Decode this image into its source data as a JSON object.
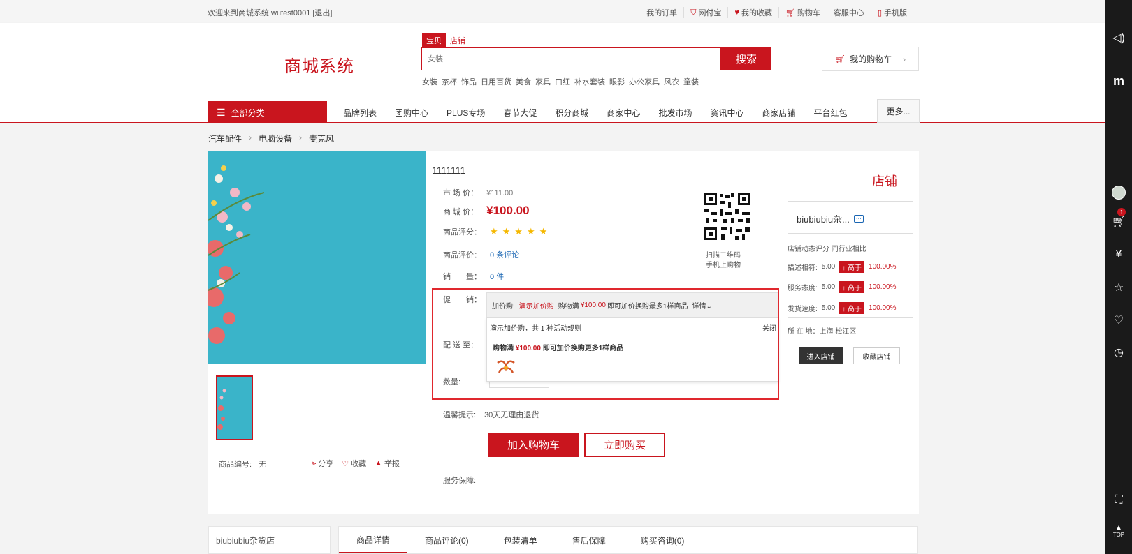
{
  "topbar": {
    "welcome": "欢迎来到商城系统 wutest0001 [退出]",
    "links": [
      "我的订单",
      "网付宝",
      "我的收藏",
      "购物车",
      "客服中心",
      "手机版"
    ]
  },
  "header": {
    "logo": "商城系统",
    "search_tabs": [
      "宝贝",
      "店铺"
    ],
    "search_placeholder": "女装",
    "search_button": "搜索",
    "hot_words": [
      "女装",
      "茶杯",
      "饰品",
      "日用百货",
      "美食",
      "家具",
      "口红",
      "补水套装",
      "眼影",
      "办公家具",
      "风衣",
      "童装"
    ],
    "cart_label": "我的购物车"
  },
  "nav": {
    "all_categories": "全部分类",
    "items": [
      "品牌列表",
      "团购中心",
      "PLUS专场",
      "春节大促",
      "积分商城",
      "商家中心",
      "批发市场",
      "资讯中心",
      "商家店铺",
      "平台红包"
    ],
    "more": "更多..."
  },
  "breadcrumb": [
    "汽车配件",
    "电脑设备",
    "麦克风"
  ],
  "product": {
    "title": "1111111",
    "market_price_label": "市 场 价：",
    "market_price": "¥111.00",
    "mall_price_label": "商 城 价：",
    "mall_price": "¥100.00",
    "rating_label": "商品评分：",
    "stars": "★★★★★",
    "review_label": "商品评价：",
    "review_value": "0 条评论",
    "sales_label": "销　　量：",
    "sales_value": "0 件",
    "promo_label": "促　　销：",
    "promo_type": "加价购:",
    "promo_name": "演示加价购",
    "promo_desc_pre": "购物满",
    "promo_amount": "¥100.00",
    "promo_desc_post": "即可加价换购最多1样商品",
    "promo_detail": "详情",
    "popup_head": "演示加价购，共 1 种活动规则",
    "popup_close": "关闭",
    "popup_rule_pre": "购物满",
    "popup_rule_amount": "¥100.00",
    "popup_rule_post": "即可加价换购更多1样商品",
    "ship_label": "配 送 至：",
    "qty_label": "数量:",
    "tip_label": "温馨提示:",
    "tip_value": "30天无理由退货",
    "add_cart": "加入购物车",
    "buy_now": "立即购买",
    "service_label": "服务保障:",
    "qr_text_1": "扫描二维码",
    "qr_text_2": "手机上购物",
    "sku_label": "商品编号:",
    "sku_value": "无",
    "share": "分享",
    "favorite": "收藏",
    "report": "举报"
  },
  "shop": {
    "title": "店铺",
    "name": "biubiubiu杂...",
    "rating_head": "店铺动态评分  同行业相比",
    "ratings": [
      {
        "label": "描述相符:",
        "score": "5.00",
        "compare": "高于",
        "pct": "100.00%"
      },
      {
        "label": "服务态度:",
        "score": "5.00",
        "compare": "高于",
        "pct": "100.00%"
      },
      {
        "label": "发货速度:",
        "score": "5.00",
        "compare": "高于",
        "pct": "100.00%"
      }
    ],
    "location": "所 在 地：上海 松江区",
    "enter": "进入店铺",
    "favorite": "收藏店铺"
  },
  "bottom": {
    "shop_name": "biubiubiu杂货店",
    "tabs": [
      "商品详情",
      "商品评论(0)",
      "包装清单",
      "售后保障",
      "购买咨询(0)"
    ]
  },
  "sidebar": {
    "cart_badge": "1",
    "top_label": "TOP"
  },
  "colors": {
    "brand": "#c9151e",
    "accent_blue": "#1a66b3",
    "star": "#f5b800"
  }
}
